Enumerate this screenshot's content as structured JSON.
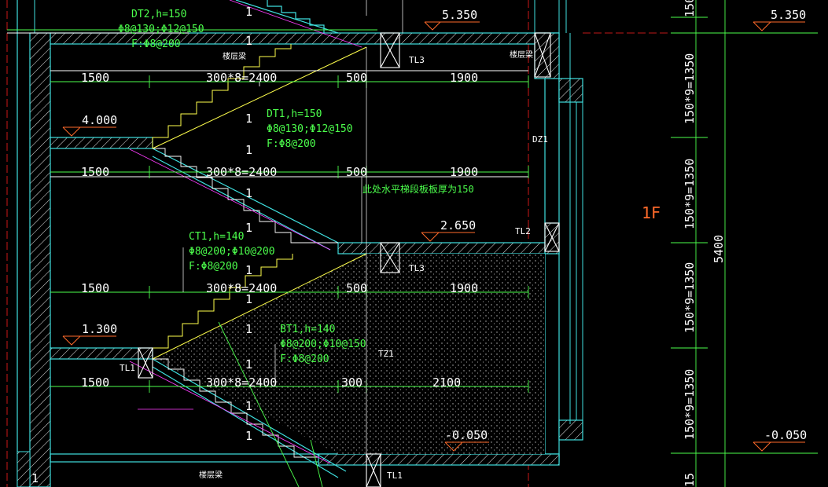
{
  "elevations": {
    "top": "5.350",
    "upper_landing": "4.000",
    "mid_landing": "2.650",
    "lower_landing": "1.300",
    "ground": "-0.050",
    "right_top": "5.350",
    "right_ground": "-0.050"
  },
  "flights": {
    "dt2": {
      "name": "DT2,h=150",
      "rebar": "Φ8@130;Φ12@150",
      "f": "F:Φ8@200"
    },
    "dt1": {
      "name": "DT1,h=150",
      "rebar": "Φ8@130;Φ12@150",
      "f": "F:Φ8@200"
    },
    "ct1": {
      "name": "CT1,h=140",
      "rebar": "Φ8@200;Φ10@200",
      "f": "F:Φ8@200"
    },
    "bt1": {
      "name": "BT1,h=140",
      "rebar": "Φ8@200;Φ10@150",
      "f": "F:Φ8@200"
    }
  },
  "dimensions": {
    "row1": [
      "1500",
      "300*8=2400",
      "500",
      "1900"
    ],
    "row2": [
      "1500",
      "300*8=2400",
      "500",
      "1900"
    ],
    "row3": [
      "1500",
      "300*8=2400",
      "500",
      "1900"
    ],
    "row4": [
      "1500",
      "300*8=2400",
      "300",
      "2100"
    ]
  },
  "vertical_dims": {
    "segments": [
      "150*9=1350",
      "150*9=1350",
      "150*9=1350",
      "150*9=1350"
    ],
    "total": "5400",
    "top_partial": "150",
    "bottom_partial": "15"
  },
  "beams": {
    "tl3_top": "TL3",
    "tl3_mid": "TL3",
    "tl1_left": "TL1",
    "tl1_bottom": "TL1",
    "tl2": "TL2",
    "dz1": "DZ1",
    "tz1": "TZ1",
    "floor_beam_top": "楼层梁",
    "floor_beam_right": "楼层梁",
    "floor_beam_bottom": "楼层梁"
  },
  "notes": {
    "slab_note": "此处水平梯段板板厚为150",
    "floor_label": "1F"
  },
  "marks": [
    "1",
    "1",
    "1",
    "1",
    "1",
    "1",
    "1",
    "1",
    "1",
    "1",
    "1",
    "1",
    "1"
  ],
  "colors": {
    "background": "#000000",
    "wall_cyan": "#3fe0e0",
    "dim_green": "#4cff4c",
    "stair_yellow": "#ffff4c",
    "magenta": "#ff3cff",
    "axis_red": "#ff2020",
    "label_orange": "#ff6a2a",
    "text_white": "#ffffff"
  }
}
